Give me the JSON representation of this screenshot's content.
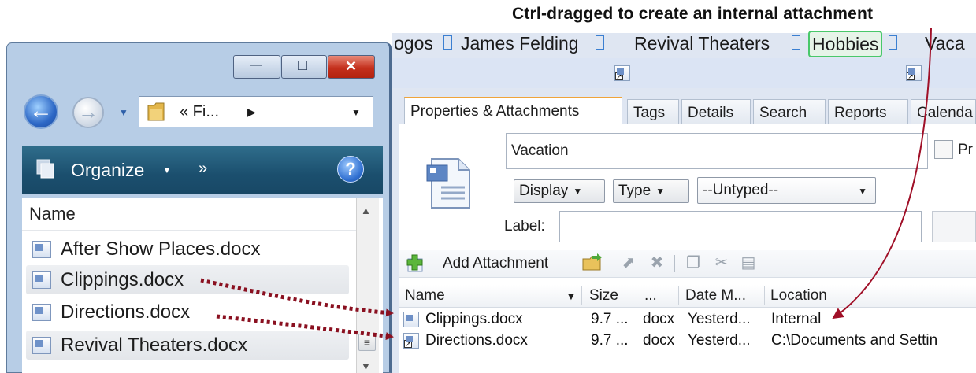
{
  "annotation": {
    "text": "Ctrl-dragged to create an internal attachment"
  },
  "breadcrumbs": [
    "ogos",
    "James Felding",
    "Revival Theaters",
    "Hobbies",
    "Vaca"
  ],
  "tabs": [
    "Properties & Attachments",
    "Tags",
    "Details",
    "Search",
    "Reports",
    "Calenda"
  ],
  "properties": {
    "name_value": "Vacation",
    "checkbox_label": "Pr",
    "display_label": "Display",
    "type_label": "Type",
    "type_value": "--Untyped--",
    "label_caption": "Label:"
  },
  "attach_toolbar": {
    "add_label": "Add Attachment"
  },
  "attachments": {
    "columns": [
      "Name",
      "Size",
      "...",
      "Date M...",
      "Location"
    ],
    "rows": [
      {
        "name": "Clippings.docx",
        "size": "9.7 ...",
        "ext": "docx",
        "date": "Yesterd...",
        "location": "Internal"
      },
      {
        "name": "Directions.docx",
        "size": "9.7 ...",
        "ext": "docx",
        "date": "Yesterd...",
        "location": "C:\\Documents and Settin"
      }
    ]
  },
  "explorer": {
    "caption_buttons": {
      "minimize": "—",
      "maximize": "□",
      "close": "✕"
    },
    "address_text": "« Fi...",
    "organize_label": "Organize",
    "more_label": "»",
    "help_label": "?",
    "column_header": "Name",
    "files": [
      "After Show Places.docx",
      "Clippings.docx",
      "Directions.docx",
      "Revival Theaters.docx"
    ]
  },
  "colors": {
    "annotation_arrow": "#a01028",
    "drag_arrow": "#8a1020",
    "accent_tab": "#f0a43a",
    "hobbies_outline": "#49c86a"
  }
}
